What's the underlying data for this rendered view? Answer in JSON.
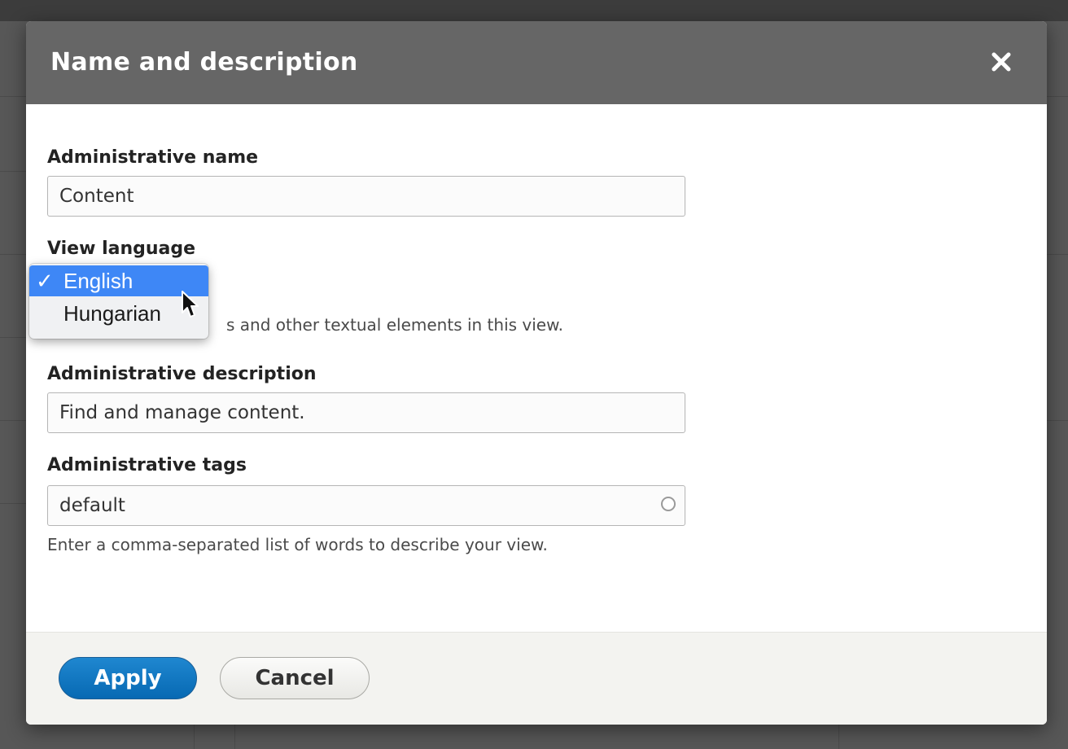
{
  "dialog": {
    "title": "Name and description"
  },
  "form": {
    "admin_name": {
      "label": "Administrative name",
      "value": "Content"
    },
    "view_language": {
      "label": "View language",
      "selected": "English",
      "options": [
        "English",
        "Hungarian"
      ],
      "description_visible": "s and other textual elements in this view."
    },
    "admin_description": {
      "label": "Administrative description",
      "value": "Find and manage content."
    },
    "admin_tags": {
      "label": "Administrative tags",
      "value": "default",
      "description": "Enter a comma-separated list of words to describe your view."
    }
  },
  "footer": {
    "apply_label": "Apply",
    "cancel_label": "Cancel"
  },
  "icons": {
    "close": "close-icon",
    "check": "✓",
    "pointer": "mouse-pointer-icon",
    "autocomplete": "autocomplete-throbber-icon"
  },
  "colors": {
    "titlebar": "#666666",
    "primary_button": "#0a72bf",
    "option_highlight": "#3e87f6"
  }
}
